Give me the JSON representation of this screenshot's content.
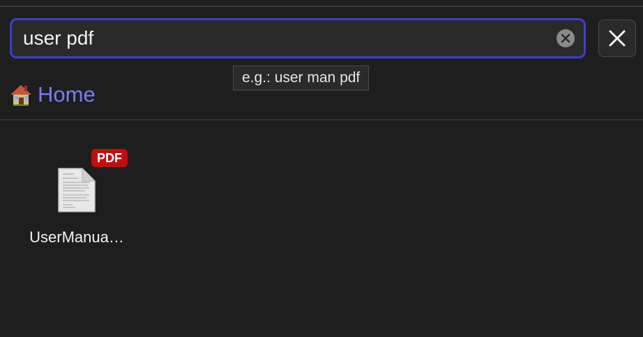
{
  "search": {
    "value": "user pdf",
    "tooltip": "e.g.: user man pdf"
  },
  "breadcrumb": {
    "home_label": "Home",
    "home_icon": "house-icon"
  },
  "files": [
    {
      "name": "UserManua…",
      "badge": "PDF",
      "icon": "document-icon"
    }
  ],
  "colors": {
    "accent_border": "#3d3fc8",
    "link": "#7a7cf5",
    "badge_bg": "#c20e0e",
    "background": "#1e1e1e"
  }
}
